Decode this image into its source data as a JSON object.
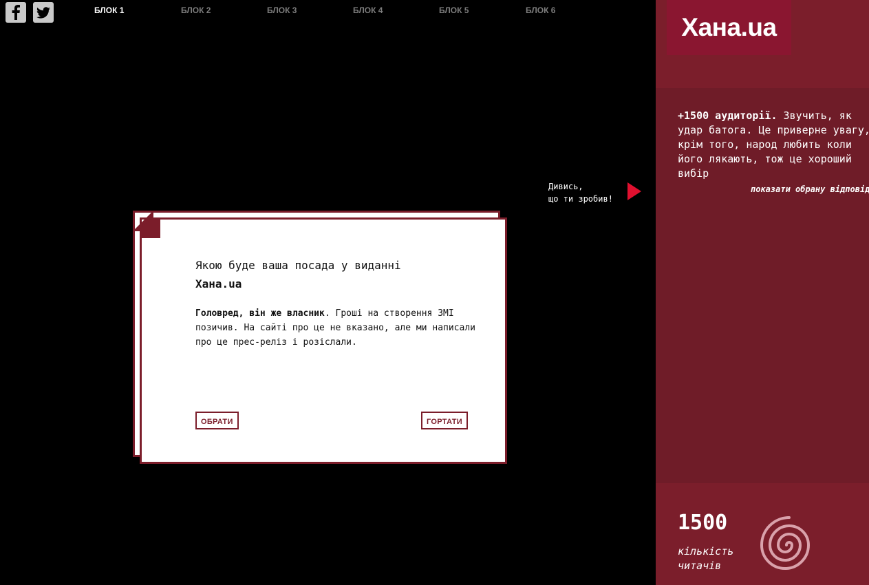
{
  "nav": {
    "items": [
      {
        "label": "БЛОК 1",
        "active": true
      },
      {
        "label": "БЛОК 2",
        "active": false
      },
      {
        "label": "БЛОК 3",
        "active": false
      },
      {
        "label": "БЛОК 4",
        "active": false
      },
      {
        "label": "БЛОК 5",
        "active": false
      },
      {
        "label": "БЛОК 6",
        "active": false
      }
    ]
  },
  "social": {
    "icons": [
      "facebook-icon",
      "twitter-icon"
    ]
  },
  "hint": {
    "line1": "Дивись,",
    "line2": "що ти зробив!"
  },
  "card": {
    "question_prefix": "Якою буде ваша посада у виданні",
    "question_brand": "Хана.ua",
    "answer_bold": "Головред, він же власник",
    "answer_rest": ". Гроші на створення ЗМІ позичив. На сайті про це не вказано, але ми написали про це прес-реліз і розіслали.",
    "choose_label": "ОБРАТИ",
    "scroll_label": "ГОРТАТИ"
  },
  "panel": {
    "logo": "Хана.ua",
    "result_bold": "+1500 аудиторії.",
    "result_rest": " Звучить, як удар батога. Це приверне увагу, крім того, народ любить коли його лякають, тож це хороший вибір",
    "show_answer": "показати обрану відповідь",
    "readers_count": "1500",
    "readers_label": "кількість читачів"
  },
  "colors": {
    "accent": "#7b1d2a",
    "logo_bg": "#8a1630",
    "panel_bg": "#6f1c28",
    "arrow": "#e0102f",
    "nav_inactive": "#7d7d7d"
  }
}
